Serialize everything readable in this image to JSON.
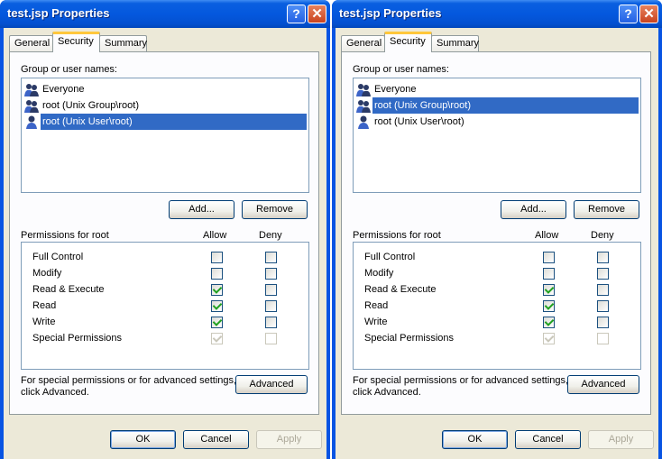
{
  "dialogs": [
    {
      "title": "test.jsp Properties",
      "title_buttons": {
        "help": "?",
        "close": "✕"
      },
      "tabs": [
        "General",
        "Security",
        "Summary"
      ],
      "group_label": "Group or user names:",
      "users": [
        {
          "label": "Everyone",
          "icon": "group-icon",
          "selected": false
        },
        {
          "label": "root (Unix Group\\root)",
          "icon": "group-icon",
          "selected": false
        },
        {
          "label": "root (Unix User\\root)",
          "icon": "user-icon",
          "selected": true
        }
      ],
      "add_label": "Add...",
      "remove_label": "Remove",
      "permissions_label": "Permissions for root",
      "allow_label": "Allow",
      "deny_label": "Deny",
      "permissions": [
        {
          "label": "Full Control",
          "allow": false,
          "deny": false,
          "disabled": false
        },
        {
          "label": "Modify",
          "allow": false,
          "deny": false,
          "disabled": false
        },
        {
          "label": "Read & Execute",
          "allow": true,
          "deny": false,
          "disabled": false
        },
        {
          "label": "Read",
          "allow": true,
          "deny": false,
          "disabled": false
        },
        {
          "label": "Write",
          "allow": true,
          "deny": false,
          "disabled": false
        },
        {
          "label": "Special Permissions",
          "allow": true,
          "deny": false,
          "disabled": true
        }
      ],
      "advanced_text_1": "For special permissions or for advanced settings,",
      "advanced_text_2": "click Advanced.",
      "advanced_label": "Advanced",
      "ok_label": "OK",
      "cancel_label": "Cancel",
      "apply_label": "Apply"
    },
    {
      "title": "test.jsp Properties",
      "title_buttons": {
        "help": "?",
        "close": "✕"
      },
      "tabs": [
        "General",
        "Security",
        "Summary"
      ],
      "group_label": "Group or user names:",
      "users": [
        {
          "label": "Everyone",
          "icon": "group-icon",
          "selected": false
        },
        {
          "label": "root (Unix Group\\root)",
          "icon": "group-icon",
          "selected": true
        },
        {
          "label": "root (Unix User\\root)",
          "icon": "user-icon",
          "selected": false
        }
      ],
      "add_label": "Add...",
      "remove_label": "Remove",
      "permissions_label": "Permissions for root",
      "allow_label": "Allow",
      "deny_label": "Deny",
      "permissions": [
        {
          "label": "Full Control",
          "allow": false,
          "deny": false,
          "disabled": false
        },
        {
          "label": "Modify",
          "allow": false,
          "deny": false,
          "disabled": false
        },
        {
          "label": "Read & Execute",
          "allow": true,
          "deny": false,
          "disabled": false
        },
        {
          "label": "Read",
          "allow": true,
          "deny": false,
          "disabled": false
        },
        {
          "label": "Write",
          "allow": true,
          "deny": false,
          "disabled": false
        },
        {
          "label": "Special Permissions",
          "allow": true,
          "deny": false,
          "disabled": true
        }
      ],
      "advanced_text_1": "For special permissions or for advanced settings,",
      "advanced_text_2": "click Advanced.",
      "advanced_label": "Advanced",
      "ok_label": "OK",
      "cancel_label": "Cancel",
      "apply_label": "Apply"
    }
  ]
}
